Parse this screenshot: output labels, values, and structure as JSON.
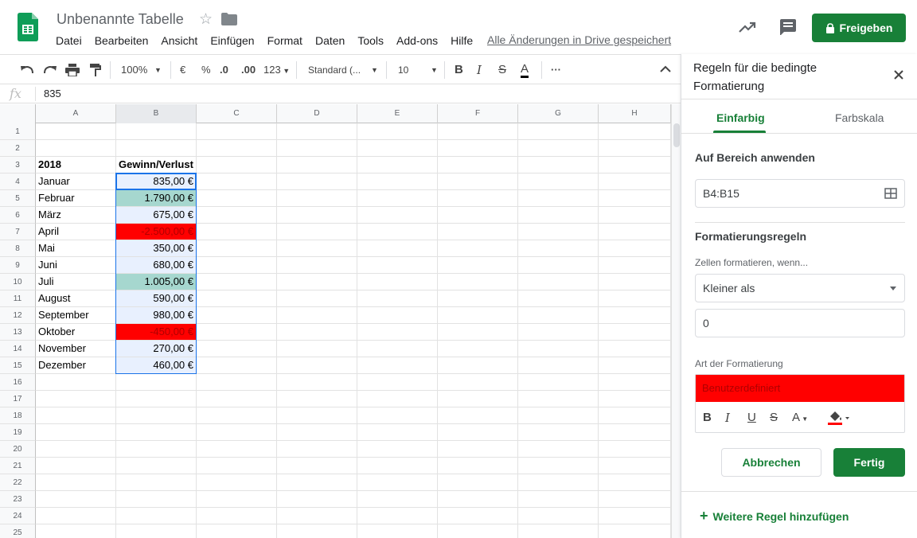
{
  "app": {
    "doc_title": "Unbenannte Tabelle",
    "menus": [
      "Datei",
      "Bearbeiten",
      "Ansicht",
      "Einfügen",
      "Format",
      "Daten",
      "Tools",
      "Add-ons",
      "Hilfe"
    ],
    "saved_status": "Alle Änderungen in Drive gespeichert",
    "share_label": "Freigeben",
    "brand_color": "#188038"
  },
  "toolbar": {
    "zoom": "100%",
    "currency": "€",
    "percent": "%",
    "dec_less": ".0",
    "dec_more": ".00",
    "more_formats": "123",
    "font": "Standard (...",
    "font_size": "10",
    "bold": "B",
    "italic": "I",
    "strike": "S",
    "text_color": "A",
    "more": "···"
  },
  "formula_bar": {
    "fx": "fx",
    "value": "835"
  },
  "sheet": {
    "columns": [
      "A",
      "B",
      "C",
      "D",
      "E",
      "F",
      "G",
      "H"
    ],
    "selected_column": "B",
    "rows": [
      {
        "n": "1",
        "a": "",
        "b": "",
        "style": ""
      },
      {
        "n": "2",
        "a": "",
        "b": "",
        "style": ""
      },
      {
        "n": "3",
        "a": "2018",
        "b": "Gewinn/Verlust",
        "style": "header"
      },
      {
        "n": "4",
        "a": "Januar",
        "b": "835,00 €",
        "style": "normal"
      },
      {
        "n": "5",
        "a": "Februar",
        "b": "1.790,00 €",
        "style": "green"
      },
      {
        "n": "6",
        "a": "März",
        "b": "675,00 €",
        "style": "normal"
      },
      {
        "n": "7",
        "a": "April",
        "b": "-2.500,00 €",
        "style": "red"
      },
      {
        "n": "8",
        "a": "Mai",
        "b": "350,00 €",
        "style": "normal"
      },
      {
        "n": "9",
        "a": "Juni",
        "b": "680,00 €",
        "style": "normal"
      },
      {
        "n": "10",
        "a": "Juli",
        "b": "1.005,00 €",
        "style": "green"
      },
      {
        "n": "11",
        "a": "August",
        "b": "590,00 €",
        "style": "normal"
      },
      {
        "n": "12",
        "a": "September",
        "b": "980,00 €",
        "style": "normal"
      },
      {
        "n": "13",
        "a": "Oktober",
        "b": "-450,00 €",
        "style": "red"
      },
      {
        "n": "14",
        "a": "November",
        "b": "270,00 €",
        "style": "normal"
      },
      {
        "n": "15",
        "a": "Dezember",
        "b": "460,00 €",
        "style": "normal"
      },
      {
        "n": "16",
        "a": "",
        "b": "",
        "style": ""
      },
      {
        "n": "17",
        "a": "",
        "b": "",
        "style": ""
      },
      {
        "n": "18",
        "a": "",
        "b": "",
        "style": ""
      },
      {
        "n": "19",
        "a": "",
        "b": "",
        "style": ""
      },
      {
        "n": "20",
        "a": "",
        "b": "",
        "style": ""
      },
      {
        "n": "21",
        "a": "",
        "b": "",
        "style": ""
      },
      {
        "n": "22",
        "a": "",
        "b": "",
        "style": ""
      },
      {
        "n": "23",
        "a": "",
        "b": "",
        "style": ""
      },
      {
        "n": "24",
        "a": "",
        "b": "",
        "style": ""
      },
      {
        "n": "25",
        "a": "",
        "b": "",
        "style": ""
      }
    ],
    "colors": {
      "in_range": "#e8f0fe",
      "green": "#a6d7cf",
      "red": "#ff0000",
      "red_text": "#b00000"
    }
  },
  "panel": {
    "title": "Regeln für die bedingte Formatierung",
    "tab_single": "Einfarbig",
    "tab_scale": "Farbskala",
    "apply_range_label": "Auf Bereich anwenden",
    "range_value": "B4:B15",
    "rules_label": "Formatierungsregeln",
    "condition_label": "Zellen formatieren, wenn...",
    "condition_value": "Kleiner als",
    "value": "0",
    "format_style_label": "Art der Formatierung",
    "format_preview": "Benutzerdefiniert",
    "fmt_bold": "B",
    "fmt_italic": "I",
    "fmt_underline": "U",
    "fmt_strike": "S",
    "fmt_text_color": "A",
    "cancel": "Abbrechen",
    "done": "Fertig",
    "add_rule": "Weitere Regel hinzufügen"
  }
}
